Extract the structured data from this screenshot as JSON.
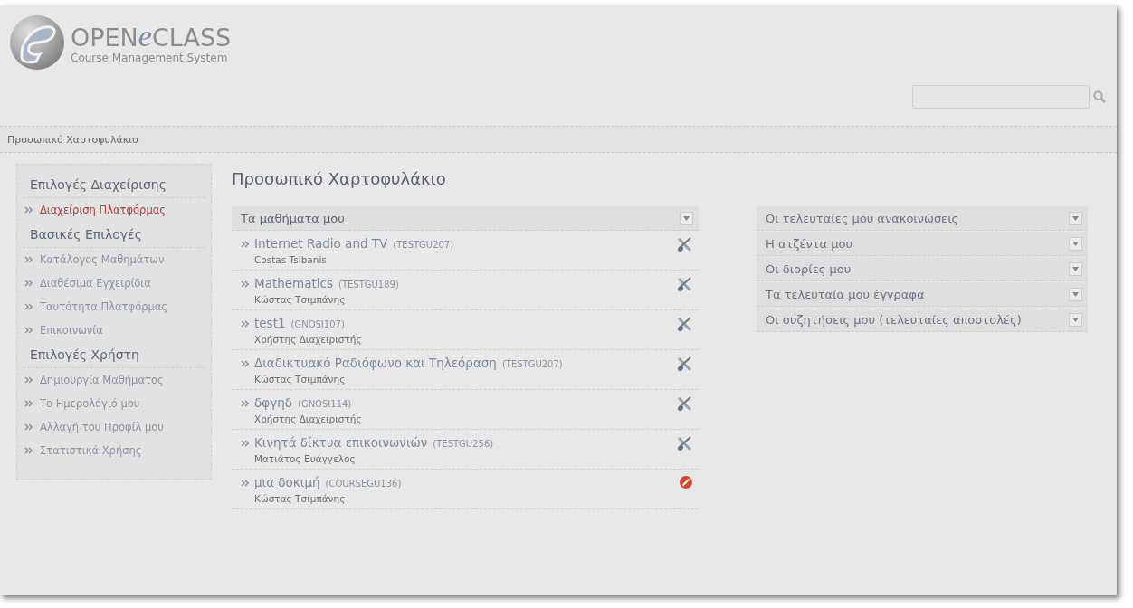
{
  "logo": {
    "prefix": "OPEN",
    "mark": "e",
    "suffix": "CLASS",
    "tagline": "Course Management System"
  },
  "breadcrumb": "Προσωπικό Χαρτοφυλάκιο",
  "sidebar": [
    {
      "heading": "Επιλογές Διαχείρισης",
      "items": [
        {
          "label": "Διαχείριση Πλατφόρμας",
          "selected": true
        }
      ]
    },
    {
      "heading": "Βασικές Επιλογές",
      "items": [
        {
          "label": "Κατάλογος Μαθημάτων",
          "selected": false
        },
        {
          "label": "Διαθέσιμα Εγχειρίδια",
          "selected": false
        },
        {
          "label": "Ταυτότητα Πλατφόρμας",
          "selected": false
        },
        {
          "label": "Επικοινωνία",
          "selected": false
        }
      ]
    },
    {
      "heading": "Επιλογές Χρήστη",
      "items": [
        {
          "label": "Δημιουργία Μαθήματος",
          "selected": false
        },
        {
          "label": "Το Ημερολόγιό μου",
          "selected": false
        },
        {
          "label": "Αλλαγή του Προφίλ μου",
          "selected": false
        },
        {
          "label": "Στατιστικά Χρήσης",
          "selected": false
        }
      ]
    }
  ],
  "page_title": "Προσωπικό Χαρτοφυλάκιο",
  "courses": {
    "title": "Τα μαθήματα μου",
    "rows": [
      {
        "name": "Internet Radio and TV",
        "code": "(TESTGU207)",
        "teacher": "Costas Tsibanis",
        "kind": "tools"
      },
      {
        "name": "Mathematics",
        "code": "(TESTGU189)",
        "teacher": "Κώστας Τσιμπάνης",
        "kind": "tools"
      },
      {
        "name": "test1",
        "code": "(GNOSI107)",
        "teacher": "Χρήστης Διαχειριστής",
        "kind": "tools"
      },
      {
        "name": "Διαδικτυακό Ραδιόφωνο και Τηλεόραση",
        "code": "(TESTGU207)",
        "teacher": "Κώστας Τσιμπάνης",
        "kind": "tools"
      },
      {
        "name": "δφγηδ",
        "code": "(GNOSI114)",
        "teacher": "Χρήστης Διαχειριστής",
        "kind": "tools"
      },
      {
        "name": "Κινητά δίκτυα επικοινωνιών",
        "code": "(TESTGU256)",
        "teacher": "Ματιάτος Ευάγγελος",
        "kind": "tools"
      },
      {
        "name": "μια δοκιμή",
        "code": "(COURSEGU136)",
        "teacher": "Κώστας Τσιμπάνης",
        "kind": "blocked"
      }
    ]
  },
  "panels": [
    {
      "title": "Οι τελευταίες μου ανακοινώσεις"
    },
    {
      "title": "Η ατζέντα μου"
    },
    {
      "title": "Οι διορίες μου"
    },
    {
      "title": "Τα τελευταία μου έγγραφα"
    },
    {
      "title": "Οι συζητήσεις μου (τελευταίες αποστολές)"
    }
  ]
}
